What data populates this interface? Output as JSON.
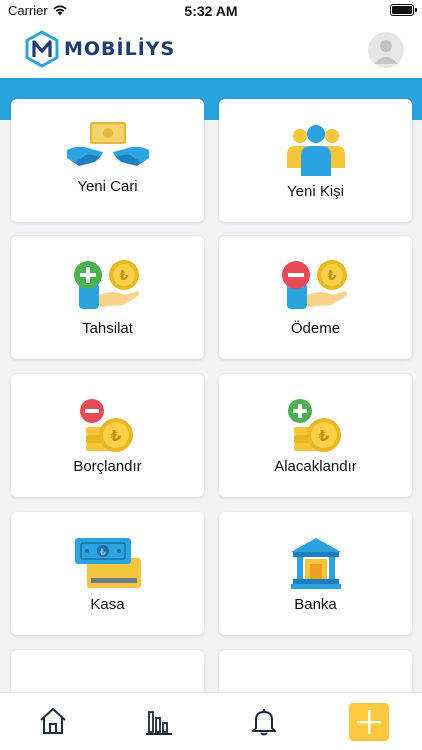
{
  "status_bar": {
    "carrier": "Carrier",
    "time": "5:32 AM"
  },
  "header": {
    "logo_text": "MOBİLİYS"
  },
  "colors": {
    "accent": "#2ba3e0",
    "brand": "#1e3c72",
    "add_button": "#ffc83d"
  },
  "menu": {
    "items": [
      {
        "label": "Yeni Cari",
        "icon": "money-hands-icon"
      },
      {
        "label": "Yeni Kişi",
        "icon": "people-group-icon"
      },
      {
        "label": "Tahsilat",
        "icon": "collection-plus-coin-icon"
      },
      {
        "label": "Ödeme",
        "icon": "payment-minus-coin-icon"
      },
      {
        "label": "Borçlandır",
        "icon": "debit-minus-coins-icon"
      },
      {
        "label": "Alacaklandır",
        "icon": "credit-plus-coins-icon"
      },
      {
        "label": "Kasa",
        "icon": "cash-register-icon"
      },
      {
        "label": "Banka",
        "icon": "bank-building-icon"
      }
    ]
  },
  "bottom_nav": {
    "items": [
      "home-icon",
      "chart-icon",
      "bell-icon",
      "add-icon"
    ]
  }
}
